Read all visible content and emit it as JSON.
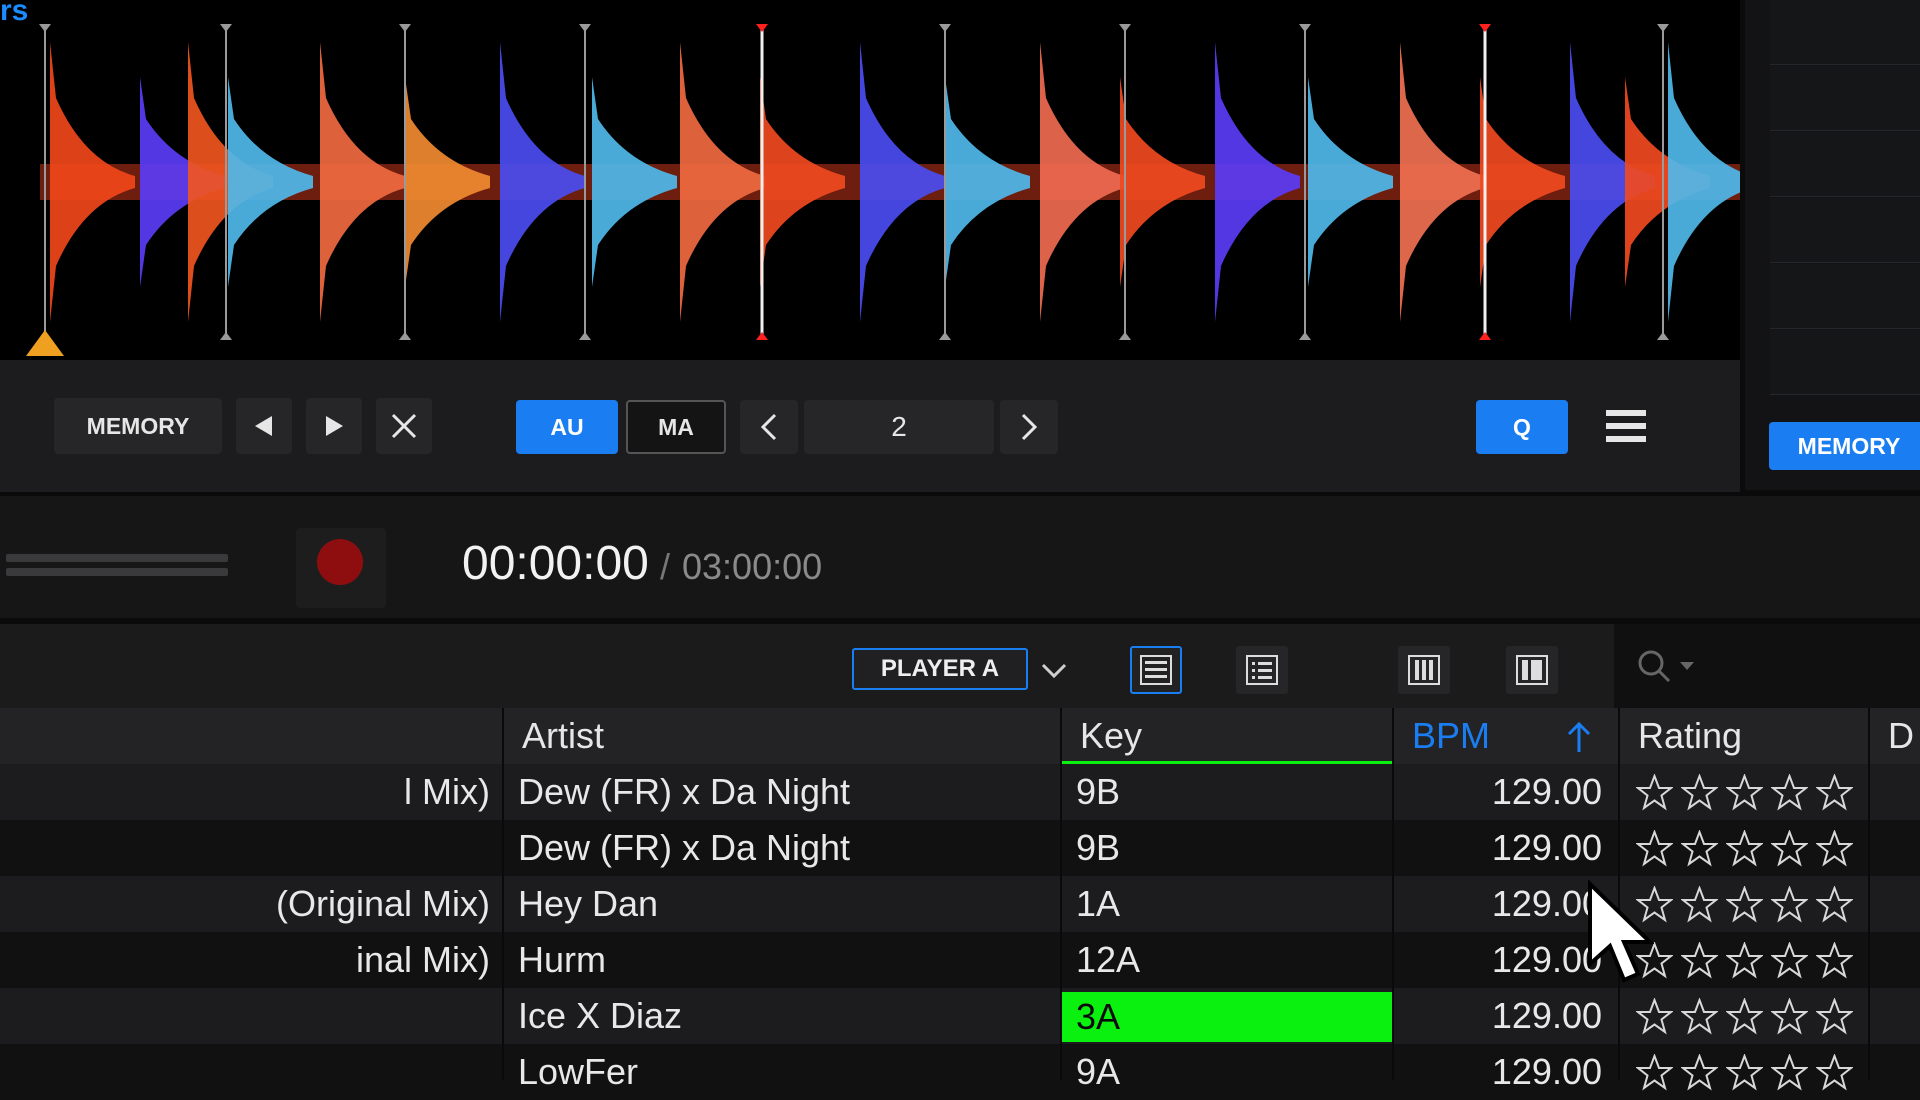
{
  "waveform": {
    "corner_label": "rs"
  },
  "cue_controls": {
    "memory_label": "MEMORY",
    "auto_label": "AU",
    "manual_label": "MA",
    "beat_value": "2",
    "quantize_label": "Q",
    "accent_color": "#1a7ef2"
  },
  "right_panel": {
    "memory_label": "MEMORY"
  },
  "recorder": {
    "current_time": "00:00:00",
    "separator": "/",
    "total_time": "03:00:00"
  },
  "browser": {
    "player_select": "PLAYER A"
  },
  "table": {
    "headers": {
      "artist": "Artist",
      "key": "Key",
      "bpm": "BPM",
      "rating": "Rating",
      "next": "D"
    },
    "sort": {
      "column": "BPM",
      "direction": "ascending"
    },
    "rows": [
      {
        "title": "l Mix)",
        "artist": "Dew (FR) x Da Night",
        "key": "9B",
        "bpm": "129.00",
        "rating": 0
      },
      {
        "title": "",
        "artist": "Dew (FR) x Da Night",
        "key": "9B",
        "bpm": "129.00",
        "rating": 0
      },
      {
        "title": "(Original Mix)",
        "artist": "Hey Dan",
        "key": "1A",
        "bpm": "129.00",
        "rating": 0
      },
      {
        "title": "inal Mix)",
        "artist": "Hurm",
        "key": "12A",
        "bpm": "129.00",
        "rating": 0
      },
      {
        "title": "",
        "artist": "Ice X Diaz",
        "key": "3A",
        "bpm": "129.00",
        "rating": 0,
        "key_highlight": "#0af00f"
      },
      {
        "title": "",
        "artist": "LowFer",
        "key": "9A",
        "bpm": "129.00",
        "rating": 0
      }
    ]
  }
}
